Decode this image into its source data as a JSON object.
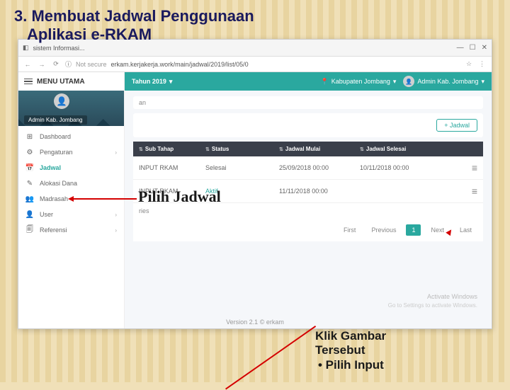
{
  "slide": {
    "title_line1": "3. Membuat Jadwal Penggunaan",
    "title_line2": "Aplikasi e-RKAM"
  },
  "browser": {
    "tab_title": "sistem Informasi...",
    "not_secure": "Not secure",
    "url": "erkam.kerjakerja.work/main/jadwal/2019/list/05/0"
  },
  "sidebar": {
    "header": "MENU UTAMA",
    "profile_name": "Admin Kab. Jombang",
    "items": [
      {
        "icon": "⊞",
        "label": "Dashboard"
      },
      {
        "icon": "⚙",
        "label": "Pengaturan",
        "chevron": true
      },
      {
        "icon": "📅",
        "label": "Jadwal",
        "active": true
      },
      {
        "icon": "✎",
        "label": "Alokasi Dana"
      },
      {
        "icon": "👥",
        "label": "Madrasah"
      },
      {
        "icon": "👤",
        "label": "User",
        "chevron": true
      },
      {
        "icon": "🗐",
        "label": "Referensi",
        "chevron": true
      }
    ]
  },
  "topbar": {
    "year_label": "Tahun 2019",
    "location": "Kabupaten Jombang",
    "user": "Admin Kab. Jombang"
  },
  "content": {
    "breadcrumb_suffix": "an",
    "add_button": "+ Jadwal",
    "table": {
      "headers": [
        "Sub Tahap",
        "Status",
        "Jadwal Mulai",
        "Jadwal Selesai"
      ],
      "rows": [
        {
          "sub": "INPUT RKAM",
          "status": "Selesai",
          "mulai": "25/09/2018 00:00",
          "selesai": "10/11/2018 00:00"
        },
        {
          "sub": "INPUT RKAM",
          "status": "Aktif",
          "mulai": "11/11/2018 00:00",
          "selesai": ""
        }
      ],
      "below_label": "ries"
    },
    "pagination": {
      "first": "First",
      "previous": "Previous",
      "page": "1",
      "next": "Next",
      "last": "Last"
    }
  },
  "footer": {
    "version": "Version 2.1 © erkam"
  },
  "watermark": {
    "line1": "Activate Windows",
    "line2": "Go to Settings to activate Windows."
  },
  "annotations": {
    "pilih_jadwal": "Pilih Jadwal",
    "klik_gambar": "Klik Gambar\nTersebut\n• Pilih Input"
  }
}
